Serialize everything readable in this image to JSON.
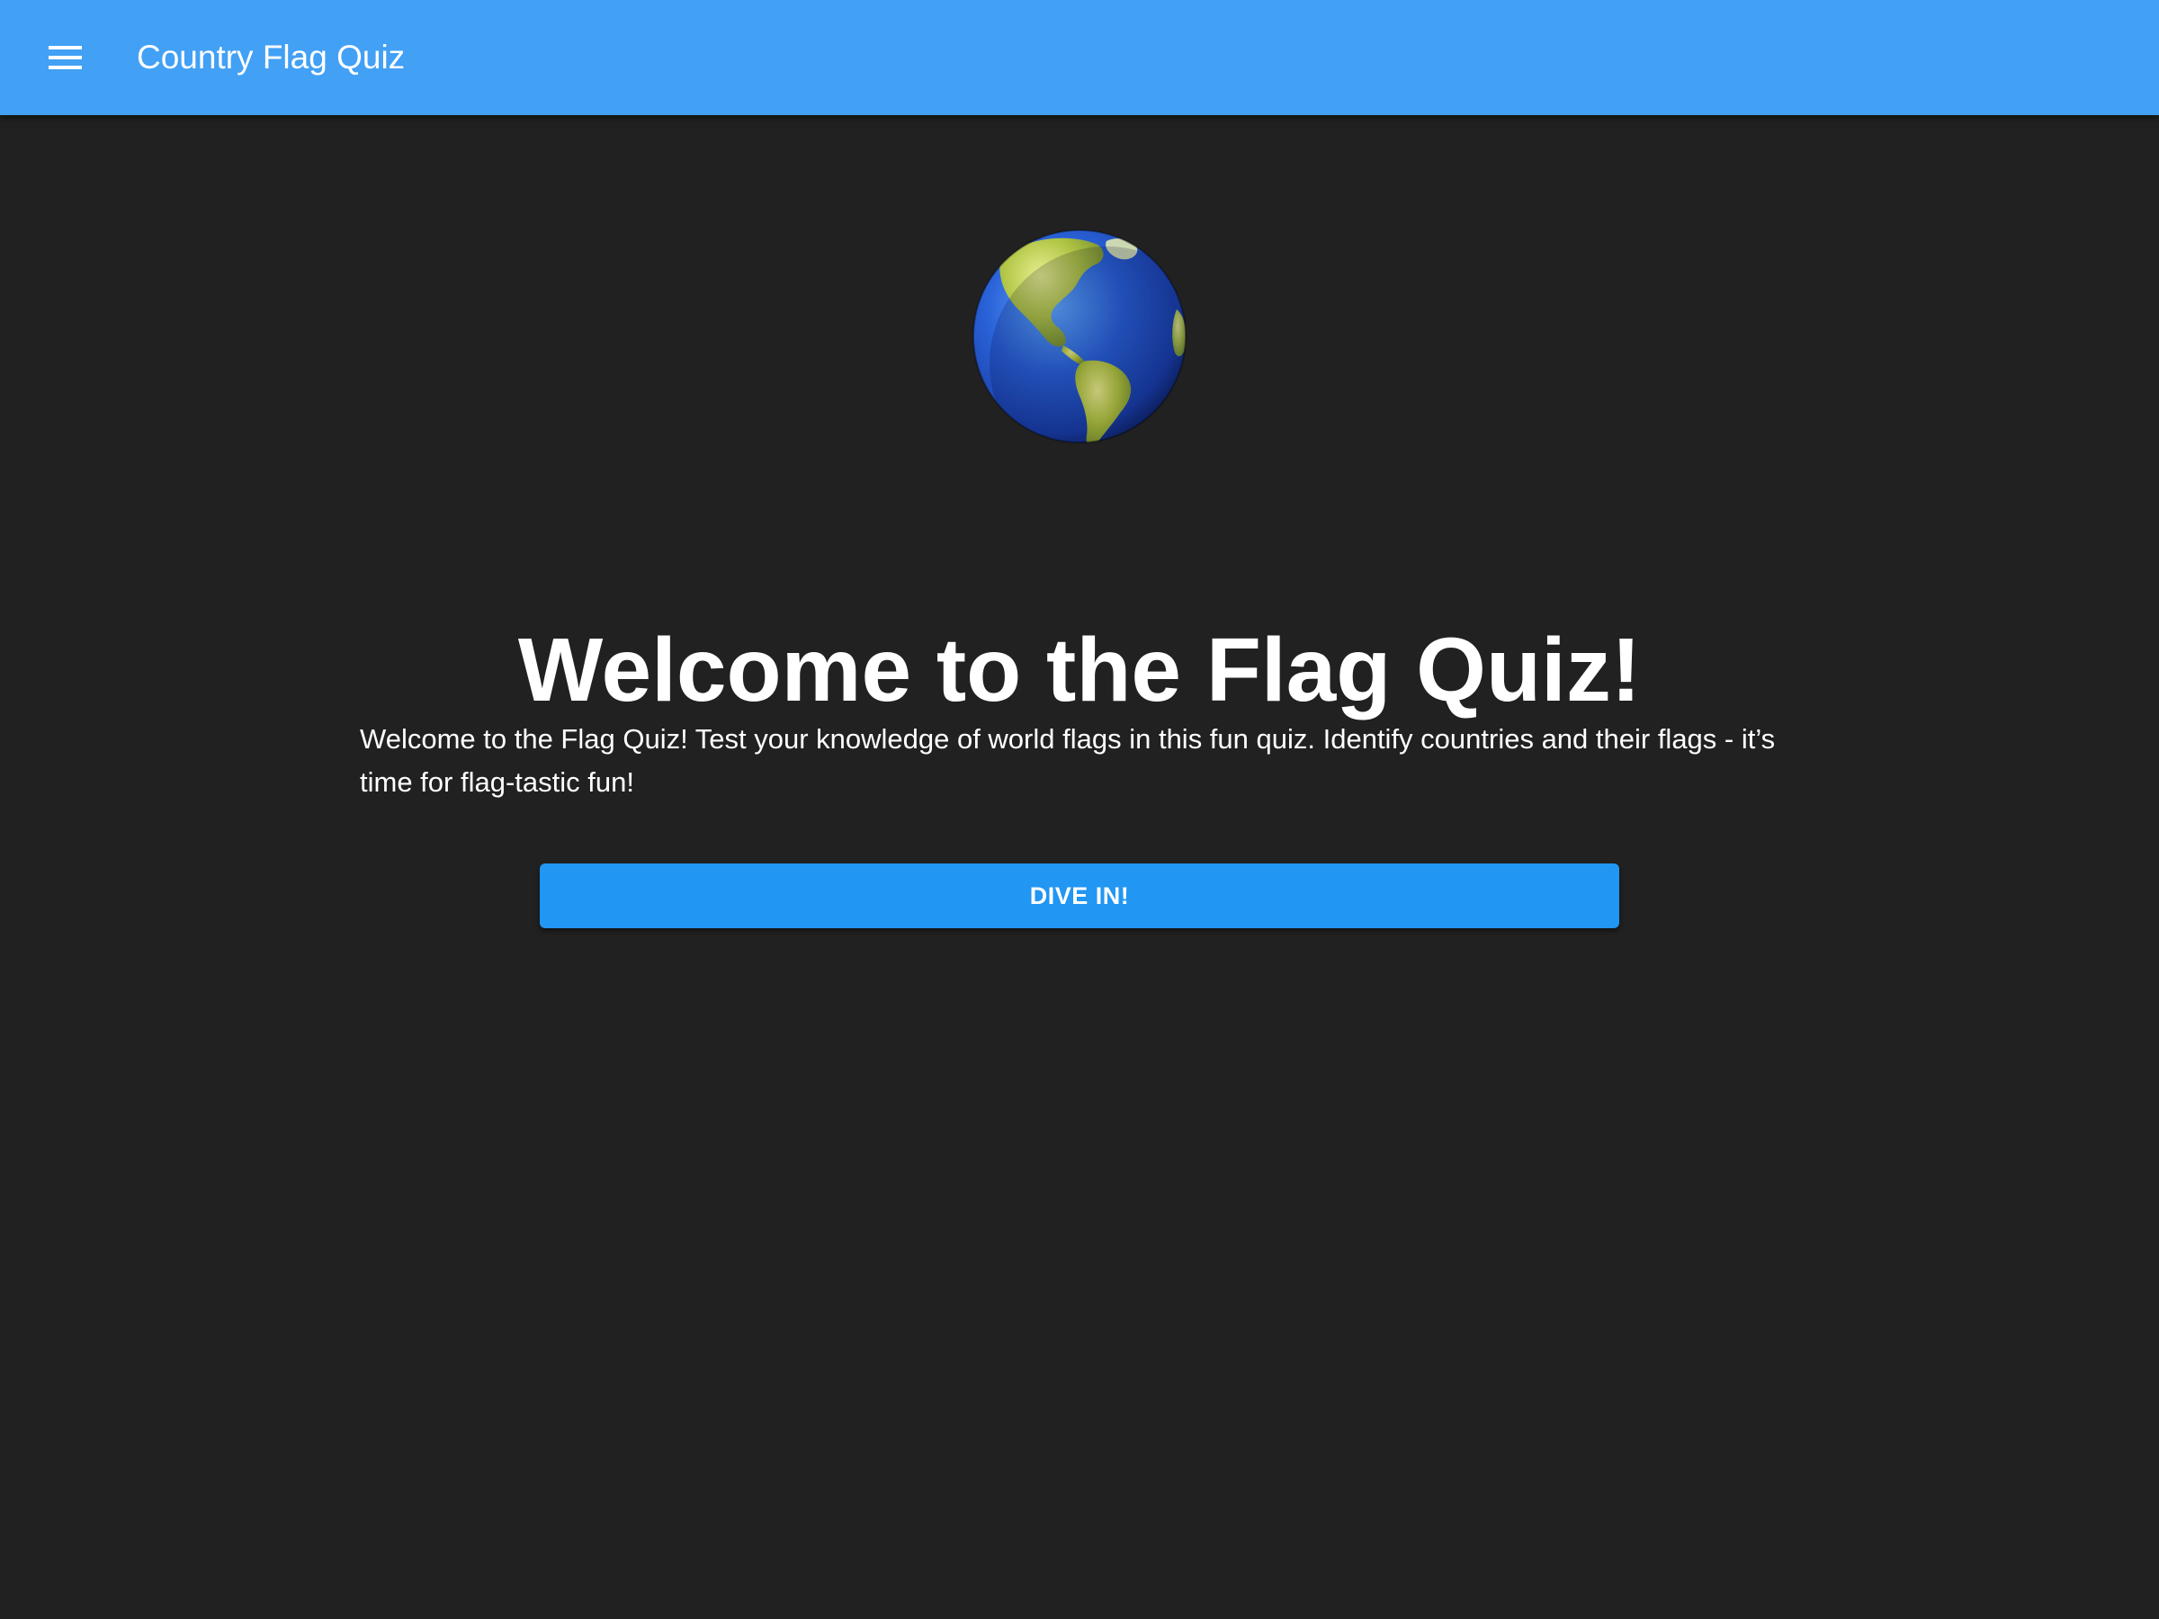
{
  "header": {
    "menu_icon": "hamburger-menu-icon",
    "title": "Country Flag Quiz",
    "color": "#42a0f5"
  },
  "hero": {
    "icon": "globe-americas-icon",
    "heading": "Welcome to the Flag Quiz!",
    "description": "Welcome to the Flag Quiz! Test your knowledge of world flags in this fun quiz. Identify countries and their flags - it’s time for flag-tastic fun!",
    "button_label": "DIVE IN!",
    "button_color": "#2196f3"
  },
  "theme": {
    "background": "#212121",
    "text": "#ffffff"
  }
}
